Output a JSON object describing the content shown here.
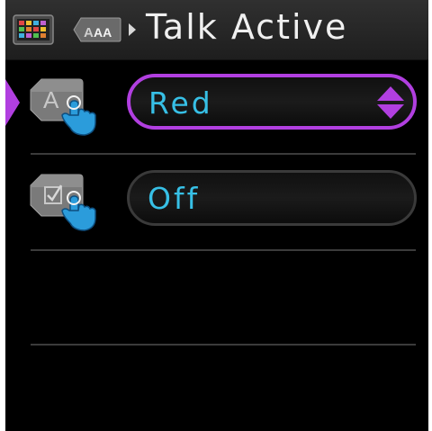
{
  "header": {
    "title": "Talk Active",
    "icons": [
      "home-grid-icon",
      "text-size-icon",
      "breadcrumb-arrow-icon"
    ]
  },
  "settings": [
    {
      "name": "text-color",
      "icon": "text-touch-icon",
      "value": "Red",
      "selected": true,
      "control": "spinner"
    },
    {
      "name": "toggle",
      "icon": "checkbox-touch-icon",
      "value": "Off",
      "selected": false,
      "control": "pill"
    }
  ],
  "colors": {
    "accent": "#b13fe0",
    "value_text": "#37c0e6",
    "background": "#000000",
    "header": "#2a2a2a"
  }
}
